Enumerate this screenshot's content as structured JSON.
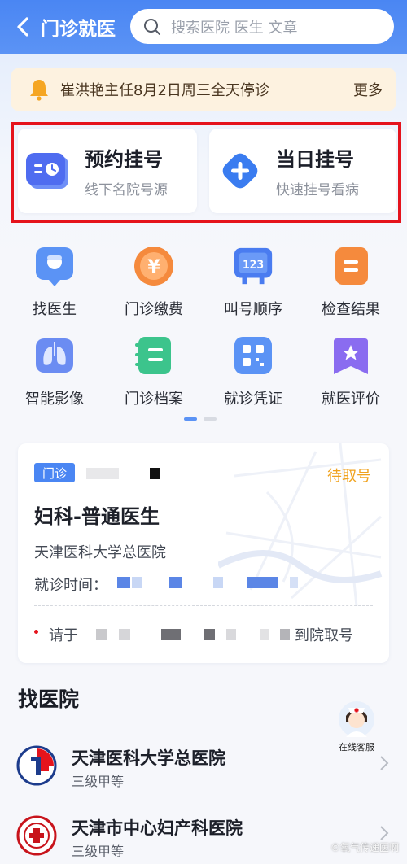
{
  "header": {
    "title": "门诊就医",
    "search_placeholder": "搜索医院 医生 文章"
  },
  "notice": {
    "text": "崔洪艳主任8月2日周三全天停诊",
    "more": "更多"
  },
  "register": [
    {
      "title": "预约挂号",
      "subtitle": "线下名院号源",
      "icon": "calendar-clock-icon"
    },
    {
      "title": "当日挂号",
      "subtitle": "快速挂号看病",
      "icon": "plus-diamond-icon"
    }
  ],
  "grid": [
    {
      "label": "找医生",
      "icon": "doctor-icon",
      "color": "#5b93f5"
    },
    {
      "label": "门诊缴费",
      "icon": "yen-coin-icon",
      "color": "#f58a3d"
    },
    {
      "label": "叫号顺序",
      "icon": "number-display-icon",
      "color": "#4a7cf0"
    },
    {
      "label": "检查结果",
      "icon": "report-icon",
      "color": "#f58a3d"
    },
    {
      "label": "智能影像",
      "icon": "lungs-icon",
      "color": "#6b8cf2"
    },
    {
      "label": "门诊档案",
      "icon": "archive-icon",
      "color": "#3cc48c"
    },
    {
      "label": "就诊凭证",
      "icon": "qr-code-icon",
      "color": "#5b93f5"
    },
    {
      "label": "就医评价",
      "icon": "star-bookmark-icon",
      "color": "#8a6cf0"
    }
  ],
  "appointment": {
    "tag": "门诊",
    "status": "待取号",
    "department": "妇科-普通医生",
    "hospital": "天津医科大学总医院",
    "time_label": "就诊时间：",
    "note_prefix": "请于",
    "note_suffix": "到院取号"
  },
  "hospitals_section": {
    "title": "找医院",
    "service_label": "在线客服"
  },
  "hospitals": [
    {
      "name": "天津医科大学总医院",
      "level": "三级甲等"
    },
    {
      "name": "天津市中心妇产科医院",
      "level": "三级甲等"
    }
  ],
  "watermark": "©氧气传递医啊",
  "colors": {
    "primary": "#4a86f3",
    "highlight_frame": "#e5131c",
    "status": "#f0a21d",
    "notice_bg": "#fdf2e0"
  }
}
